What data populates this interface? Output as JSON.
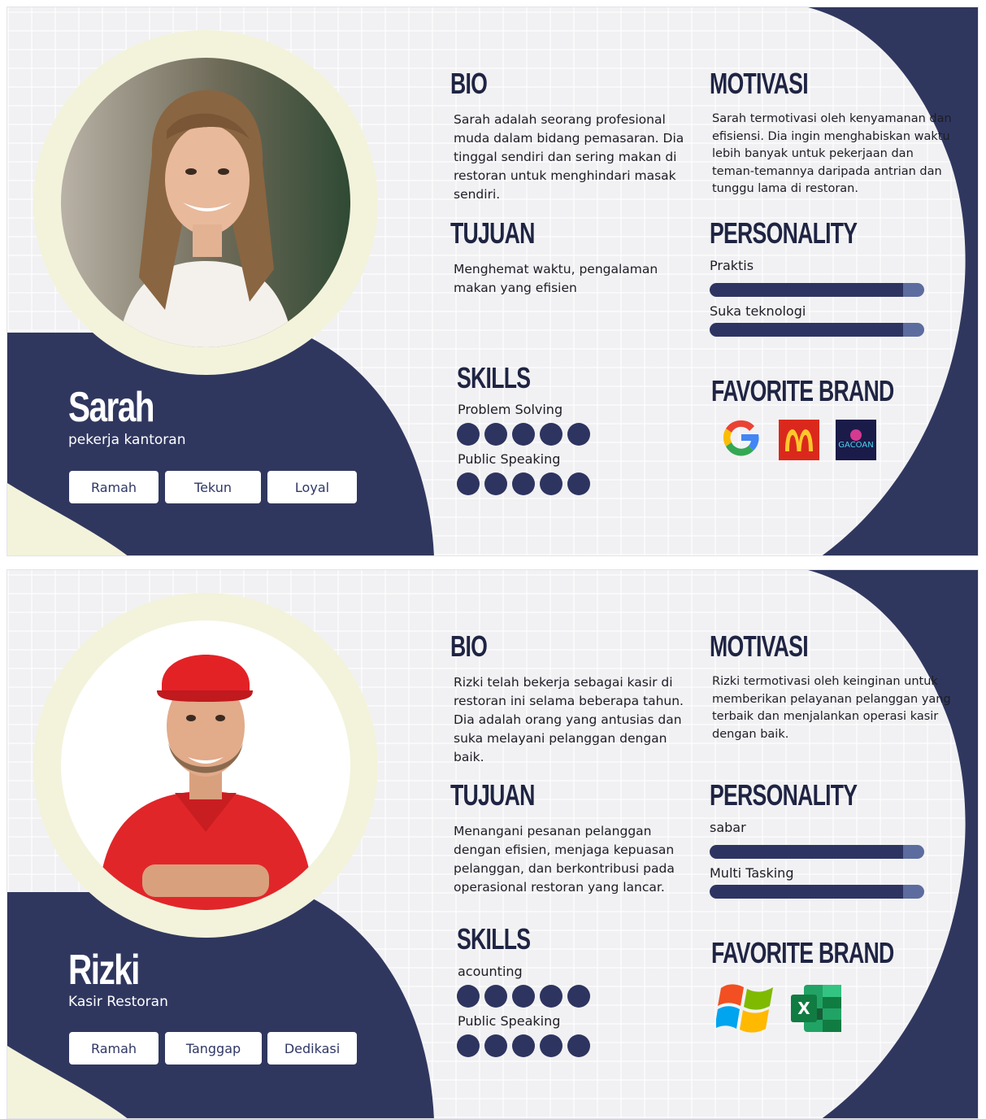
{
  "personas": [
    {
      "name": "Sarah",
      "role": "pekerja kantoran",
      "tags": [
        "Ramah",
        "Tekun",
        "Loyal"
      ],
      "bio_title": "BIO",
      "bio": "Sarah adalah seorang profesional muda dalam bidang pemasaran. Dia tinggal sendiri dan sering makan di restoran untuk menghindari masak sendiri.",
      "motivasi_title": "MOTIVASI",
      "motivasi": "Sarah termotivasi oleh kenyamanan dan efisiensi. Dia ingin menghabiskan waktu lebih banyak untuk pekerjaan dan teman-temannya daripada antrian dan tunggu lama di restoran.",
      "tujuan_title": "TUJUAN",
      "tujuan": "Menghemat waktu, pengalaman makan yang efisien",
      "personality_title": "PERSONALITY",
      "personality": [
        {
          "label": "Praktis",
          "level": 0.9
        },
        {
          "label": "Suka teknologi",
          "level": 0.9
        }
      ],
      "skills_title": "SKILLS",
      "skills": [
        {
          "label": "Problem Solving",
          "dots": 5
        },
        {
          "label": "Public Speaking",
          "dots": 5
        }
      ],
      "brand_title": "FAVORITE BRAND",
      "brands": [
        {
          "icon": "google-logo-icon"
        },
        {
          "icon": "mcdonalds-logo-icon",
          "color": "#da291c"
        },
        {
          "icon": "gacoan-logo-icon",
          "text": "GACOAN"
        }
      ],
      "photo": "woman-portrait"
    },
    {
      "name": "Rizki",
      "role": "Kasir Restoran",
      "tags": [
        "Ramah",
        "Tanggap",
        "Dedikasi"
      ],
      "bio_title": "BIO",
      "bio": "Rizki telah bekerja sebagai kasir di restoran ini selama beberapa tahun. Dia adalah orang yang antusias dan suka melayani pelanggan dengan baik.",
      "motivasi_title": "MOTIVASI",
      "motivasi": "Rizki termotivasi oleh keinginan untuk memberikan pelayanan pelanggan yang terbaik dan menjalankan operasi kasir dengan baik.",
      "tujuan_title": "TUJUAN",
      "tujuan": "Menangani pesanan pelanggan dengan efisien, menjaga kepuasan pelanggan, dan berkontribusi pada operasional restoran yang lancar.",
      "personality_title": "PERSONALITY",
      "personality": [
        {
          "label": "sabar",
          "level": 0.9
        },
        {
          "label": "Multi Tasking",
          "level": 0.9
        }
      ],
      "skills_title": "SKILLS",
      "skills": [
        {
          "label": "acounting",
          "dots": 5
        },
        {
          "label": "Public Speaking",
          "dots": 5
        }
      ],
      "brand_title": "FAVORITE BRAND",
      "brands": [
        {
          "icon": "windows-logo-icon"
        },
        {
          "icon": "excel-logo-icon",
          "text": "X"
        }
      ],
      "photo": "man-portrait"
    }
  ],
  "colors": {
    "navy": "#30375f",
    "cream": "#f3f3dc",
    "bar_light": "#5d6c9e"
  }
}
